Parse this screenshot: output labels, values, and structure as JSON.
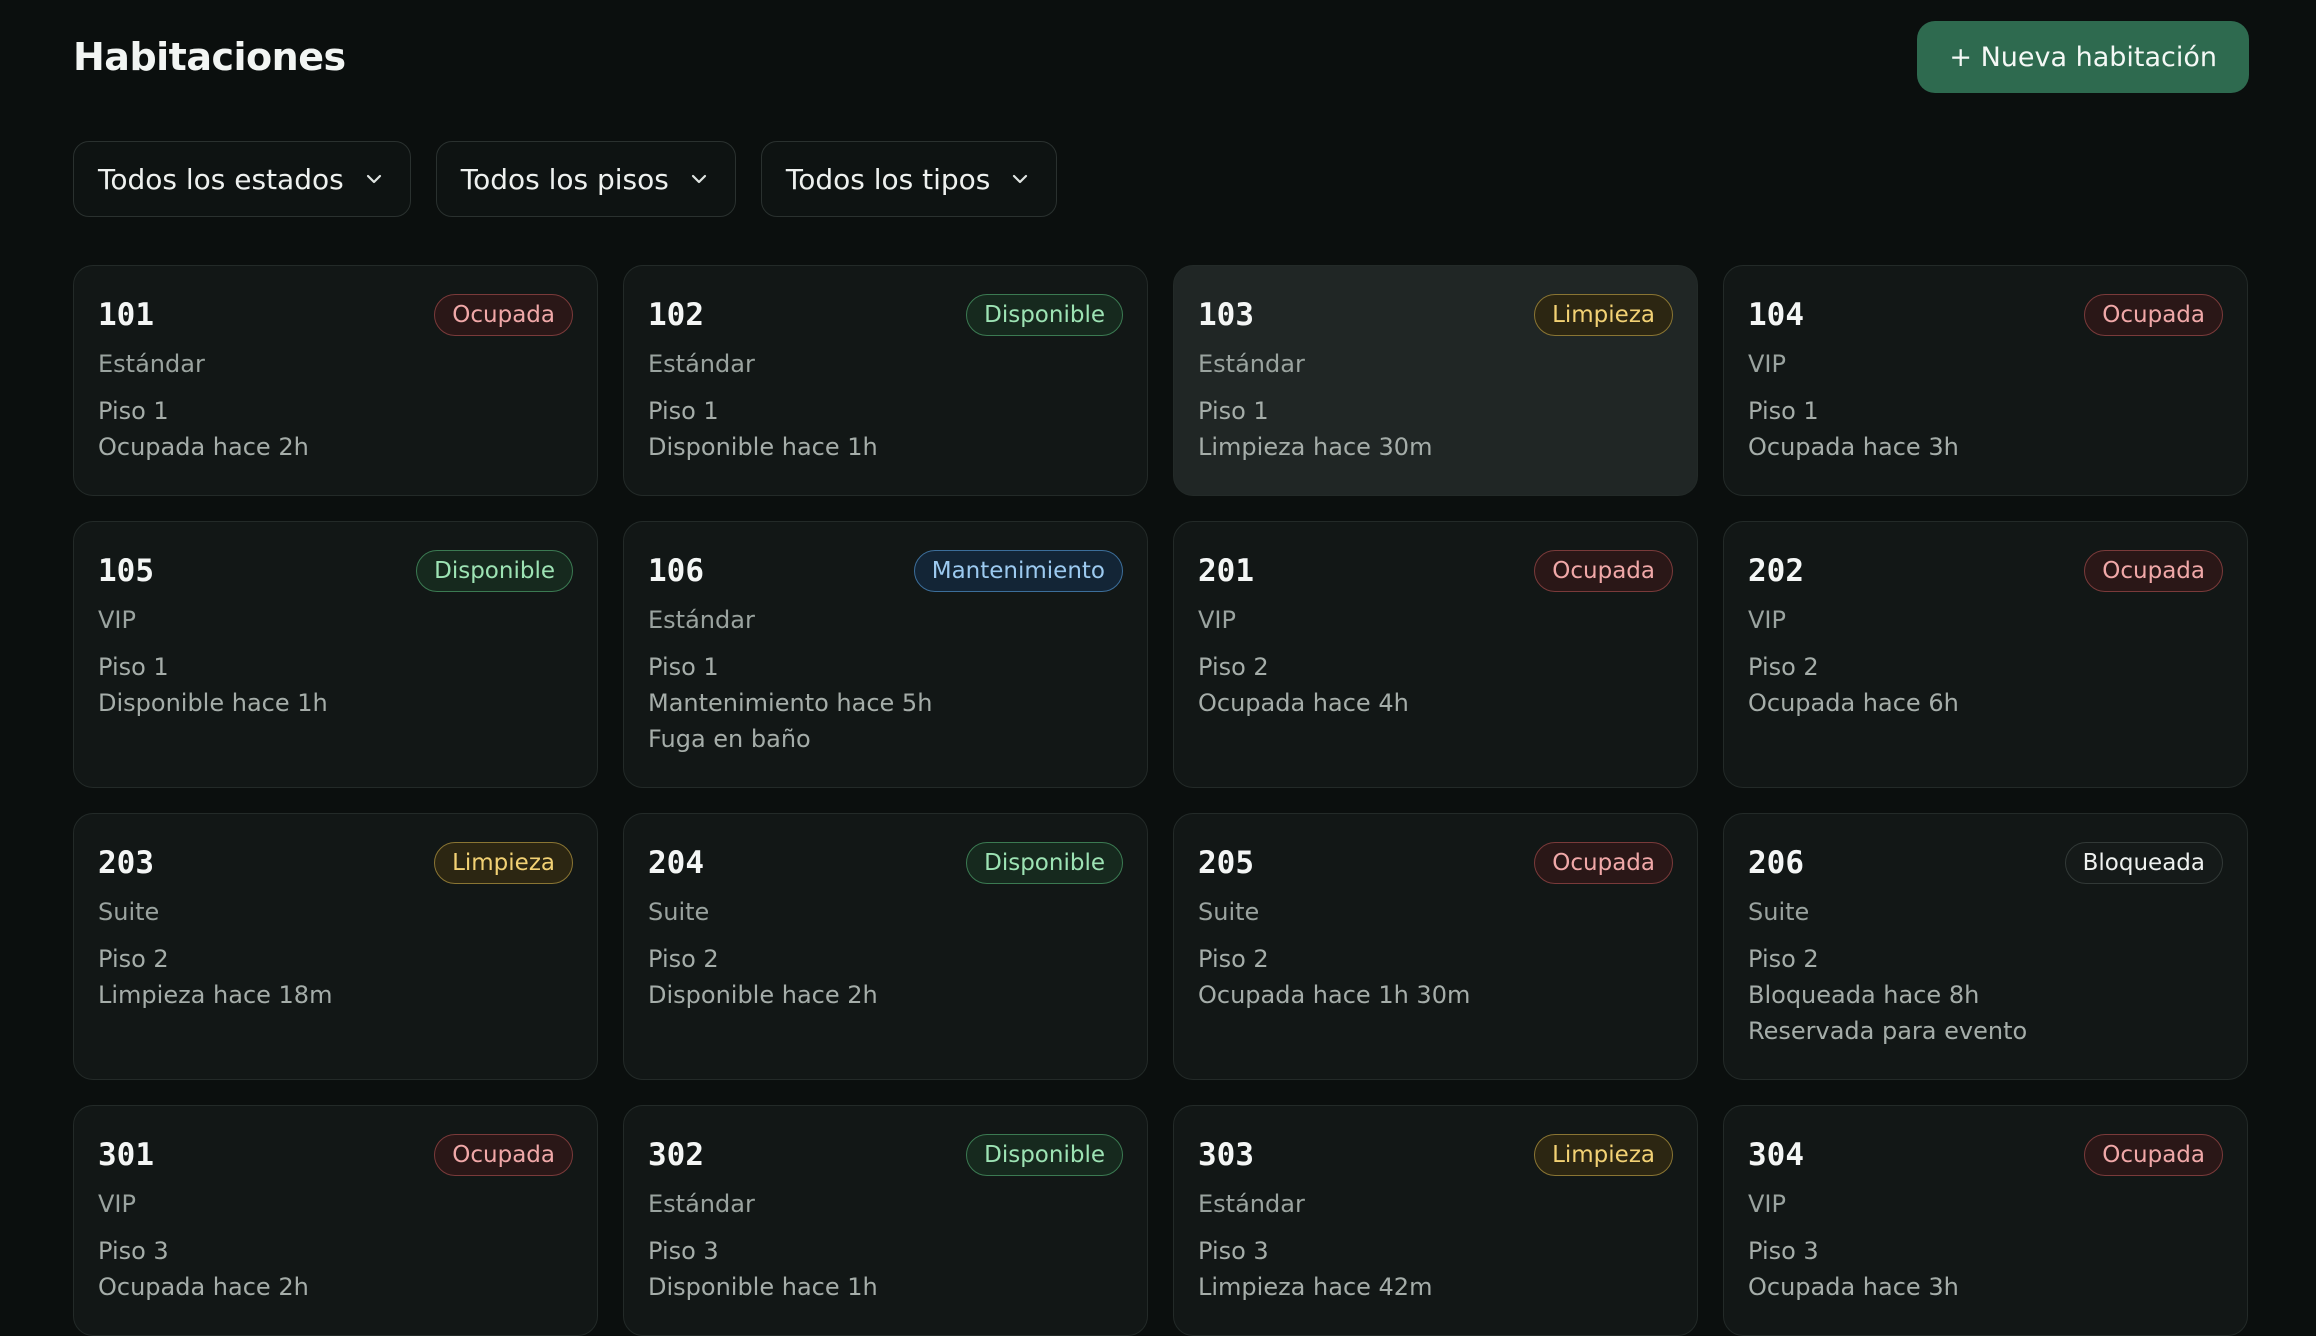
{
  "header": {
    "title": "Habitaciones",
    "new_button": "+ Nueva habitación"
  },
  "filters": [
    {
      "label": "Todos los estados"
    },
    {
      "label": "Todos los pisos"
    },
    {
      "label": "Todos los tipos"
    }
  ],
  "colors": {
    "background": "#0b0f0e",
    "accent": "#2e6a4f",
    "ocupada": "#f0a8a8",
    "disponible": "#9de3b4",
    "limpieza": "#f2d174",
    "mantenimiento": "#9ccaf0",
    "bloqueada": "#eef1ef"
  },
  "rooms": [
    {
      "number": "101",
      "status": "Ocupada",
      "type": "Estándar",
      "floor": "Piso 1",
      "since": "Ocupada hace 2h"
    },
    {
      "number": "102",
      "status": "Disponible",
      "type": "Estándar",
      "floor": "Piso 1",
      "since": "Disponible hace 1h"
    },
    {
      "number": "103",
      "status": "Limpieza",
      "type": "Estándar",
      "floor": "Piso 1",
      "since": "Limpieza hace 30m"
    },
    {
      "number": "104",
      "status": "Ocupada",
      "type": "VIP",
      "floor": "Piso 1",
      "since": "Ocupada hace 3h"
    },
    {
      "number": "105",
      "status": "Disponible",
      "type": "VIP",
      "floor": "Piso 1",
      "since": "Disponible hace 1h"
    },
    {
      "number": "106",
      "status": "Mantenimiento",
      "type": "Estándar",
      "floor": "Piso 1",
      "since": "Mantenimiento hace 5h",
      "note": "Fuga en baño"
    },
    {
      "number": "201",
      "status": "Ocupada",
      "type": "VIP",
      "floor": "Piso 2",
      "since": "Ocupada hace 4h"
    },
    {
      "number": "202",
      "status": "Ocupada",
      "type": "VIP",
      "floor": "Piso 2",
      "since": "Ocupada hace 6h"
    },
    {
      "number": "203",
      "status": "Limpieza",
      "type": "Suite",
      "floor": "Piso 2",
      "since": "Limpieza hace 18m"
    },
    {
      "number": "204",
      "status": "Disponible",
      "type": "Suite",
      "floor": "Piso 2",
      "since": "Disponible hace 2h"
    },
    {
      "number": "205",
      "status": "Ocupada",
      "type": "Suite",
      "floor": "Piso 2",
      "since": "Ocupada hace 1h 30m"
    },
    {
      "number": "206",
      "status": "Bloqueada",
      "type": "Suite",
      "floor": "Piso 2",
      "since": "Bloqueada hace 8h",
      "note": "Reservada para evento"
    },
    {
      "number": "301",
      "status": "Ocupada",
      "type": "VIP",
      "floor": "Piso 3",
      "since": "Ocupada hace 2h"
    },
    {
      "number": "302",
      "status": "Disponible",
      "type": "Estándar",
      "floor": "Piso 3",
      "since": "Disponible hace 1h"
    },
    {
      "number": "303",
      "status": "Limpieza",
      "type": "Estándar",
      "floor": "Piso 3",
      "since": "Limpieza hace 42m"
    },
    {
      "number": "304",
      "status": "Ocupada",
      "type": "VIP",
      "floor": "Piso 3",
      "since": "Ocupada hace 3h"
    }
  ]
}
